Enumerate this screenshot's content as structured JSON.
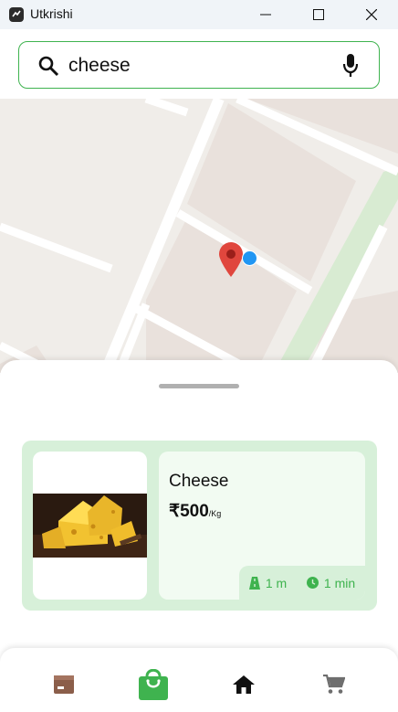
{
  "window": {
    "title": "Utkrishi"
  },
  "search": {
    "value": "cheese",
    "placeholder": ""
  },
  "results": [
    {
      "name": "Cheese",
      "price": "₹500",
      "unit": "/Kg",
      "distance": "1 m",
      "time": "1 min"
    }
  ],
  "nav": [
    "orders",
    "bag",
    "home",
    "cart"
  ],
  "colors": {
    "accent": "#3fb34f",
    "card_bg": "#d7f0d9",
    "pin": "#e0463d",
    "location_dot": "#2196f3"
  }
}
